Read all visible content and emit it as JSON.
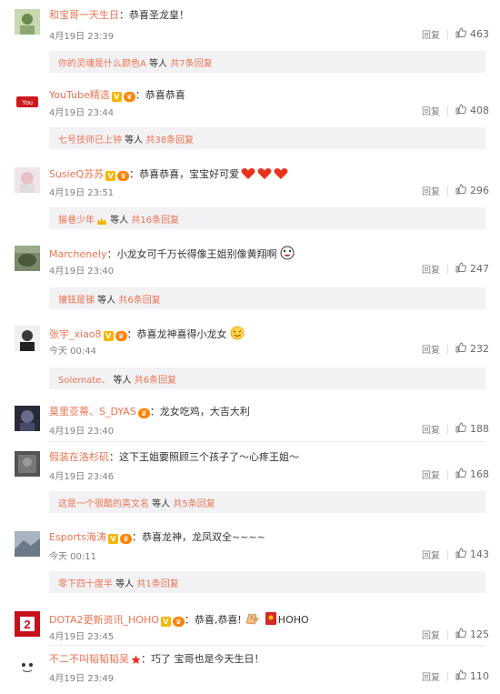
{
  "comments": [
    {
      "user": "和宝哥一天生日",
      "text": "：恭喜圣龙皇！",
      "time": "4月19日 23:39",
      "reply_label": "回复",
      "likes": "463",
      "replies": {
        "who": "你的灵魂是什么颜色A",
        "how": " 等人 ",
        "more": "共7条回复"
      }
    },
    {
      "user": "YouTube精选",
      "text": "：恭喜恭喜",
      "time": "4月19日 23:44",
      "reply_label": "回复",
      "likes": "408",
      "replies": {
        "who": "七号技师已上钟",
        "how": " 等人 ",
        "more": "共38条回复"
      }
    },
    {
      "user": "SusieQ苏苏",
      "text": "：恭喜恭喜，宝宝好可爱",
      "time": "4月19日 23:51",
      "reply_label": "回复",
      "likes": "296",
      "replies": {
        "who": "猫巷少年",
        "how": " 等人 ",
        "more": "共16条回复"
      }
    },
    {
      "user": "Marchenely",
      "text": "：小龙女可千万长得像王姐别像黄翔啊",
      "time": "4月19日 23:40",
      "reply_label": "回复",
      "likes": "247",
      "replies": {
        "who": "镶铥是锑",
        "how": " 等人 ",
        "more": "共6条回复"
      }
    },
    {
      "user": "张宇_xiao8",
      "text": "：恭喜龙神喜得小龙女",
      "time": "今天 00:44",
      "reply_label": "回复",
      "likes": "232",
      "replies": {
        "who": "Solemate、",
        "how": " 等人 ",
        "more": "共6条回复"
      }
    },
    {
      "user": "莫里亚蒂、S_DYAS",
      "text": "：龙女吃鸡，大吉大利",
      "time": "4月19日 23:40",
      "reply_label": "回复",
      "likes": "188"
    },
    {
      "user": "假装在洛杉矶",
      "text": "：这下王姐要照顾三个孩子了～心疼王姐～",
      "time": "4月19日 23:46",
      "reply_label": "回复",
      "likes": "168",
      "replies": {
        "who": "这是一个很酷的英文名",
        "how": " 等人 ",
        "more": "共5条回复"
      }
    },
    {
      "user": "Esports海涛",
      "text": "：恭喜龙神，龙凤双全~~~~",
      "time": "今天 00:11",
      "reply_label": "回复",
      "likes": "143",
      "replies": {
        "who": "零下四十度半",
        "how": " 等人 ",
        "more": "共1条回复"
      }
    },
    {
      "user": "DOTA2更新资讯_HOHO",
      "text": "：恭喜,恭喜!",
      "text2": "HOHO",
      "time": "4月19日 23:45",
      "reply_label": "回复",
      "likes": "125"
    },
    {
      "user": "不二不叫韬韬韬吴",
      "text": "：巧了 宝哥也是今天生日！",
      "time": "4月19日 23:49",
      "reply_label": "回复",
      "likes": "110"
    }
  ]
}
